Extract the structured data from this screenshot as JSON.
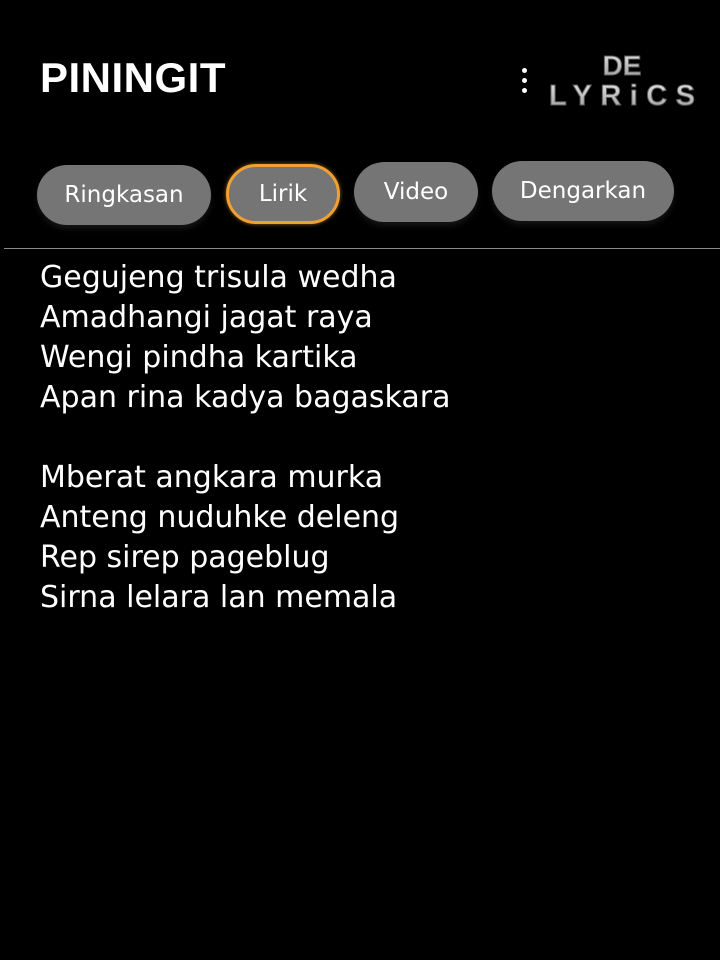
{
  "header": {
    "title": "PININGIT",
    "logo_text_top": "DE",
    "logo_text_bottom": "LYRiCS",
    "menu_icon": "more-vertical-icon"
  },
  "tabs": [
    {
      "label": "Ringkasan",
      "active": false
    },
    {
      "label": "Lirik",
      "active": true
    },
    {
      "label": "Video",
      "active": false
    },
    {
      "label": "Dengarkan",
      "active": false
    }
  ],
  "lyrics": {
    "stanzas": [
      {
        "lines": [
          "Gegujeng trisula wedha",
          "Amadhangi jagat raya",
          "Wengi pindha kartika",
          "Apan rina kadya bagaskara"
        ]
      },
      {
        "lines": [
          "Mberat angkara murka",
          "Anteng nuduhke deleng",
          "Rep sirep pageblug",
          "Sirna lelara lan memala"
        ]
      }
    ]
  },
  "colors": {
    "background": "#000000",
    "text": "#ffffff",
    "tab_background": "#757575",
    "active_tab_border": "#f0a032",
    "divider": "#8a8a8a",
    "logo": "#c8c8c8"
  }
}
